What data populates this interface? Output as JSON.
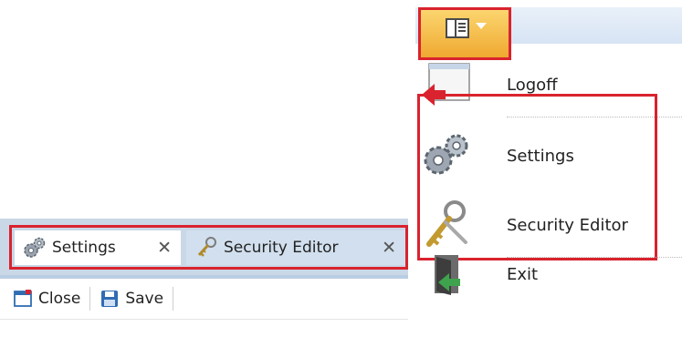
{
  "tabs": [
    {
      "label": "Settings",
      "icon": "gears-icon",
      "active": true,
      "close_glyph": "✕"
    },
    {
      "label": "Security Editor",
      "icon": "keys-icon",
      "active": false,
      "close_glyph": "✕"
    }
  ],
  "toolbar": {
    "close_label": "Close",
    "save_label": "Save"
  },
  "app_menu": {
    "button_icon": "app-menu-icon",
    "items": [
      {
        "label": "Logoff",
        "icon": "logoff-icon"
      },
      {
        "label": "Settings",
        "icon": "gears-icon"
      },
      {
        "label": "Security Editor",
        "icon": "keys-icon"
      },
      {
        "label": "Exit",
        "icon": "exit-door-icon"
      }
    ]
  },
  "colors": {
    "highlight": "#d9232e",
    "tabstrip": "#c9d7e7",
    "app_button": "#f3b94a"
  }
}
